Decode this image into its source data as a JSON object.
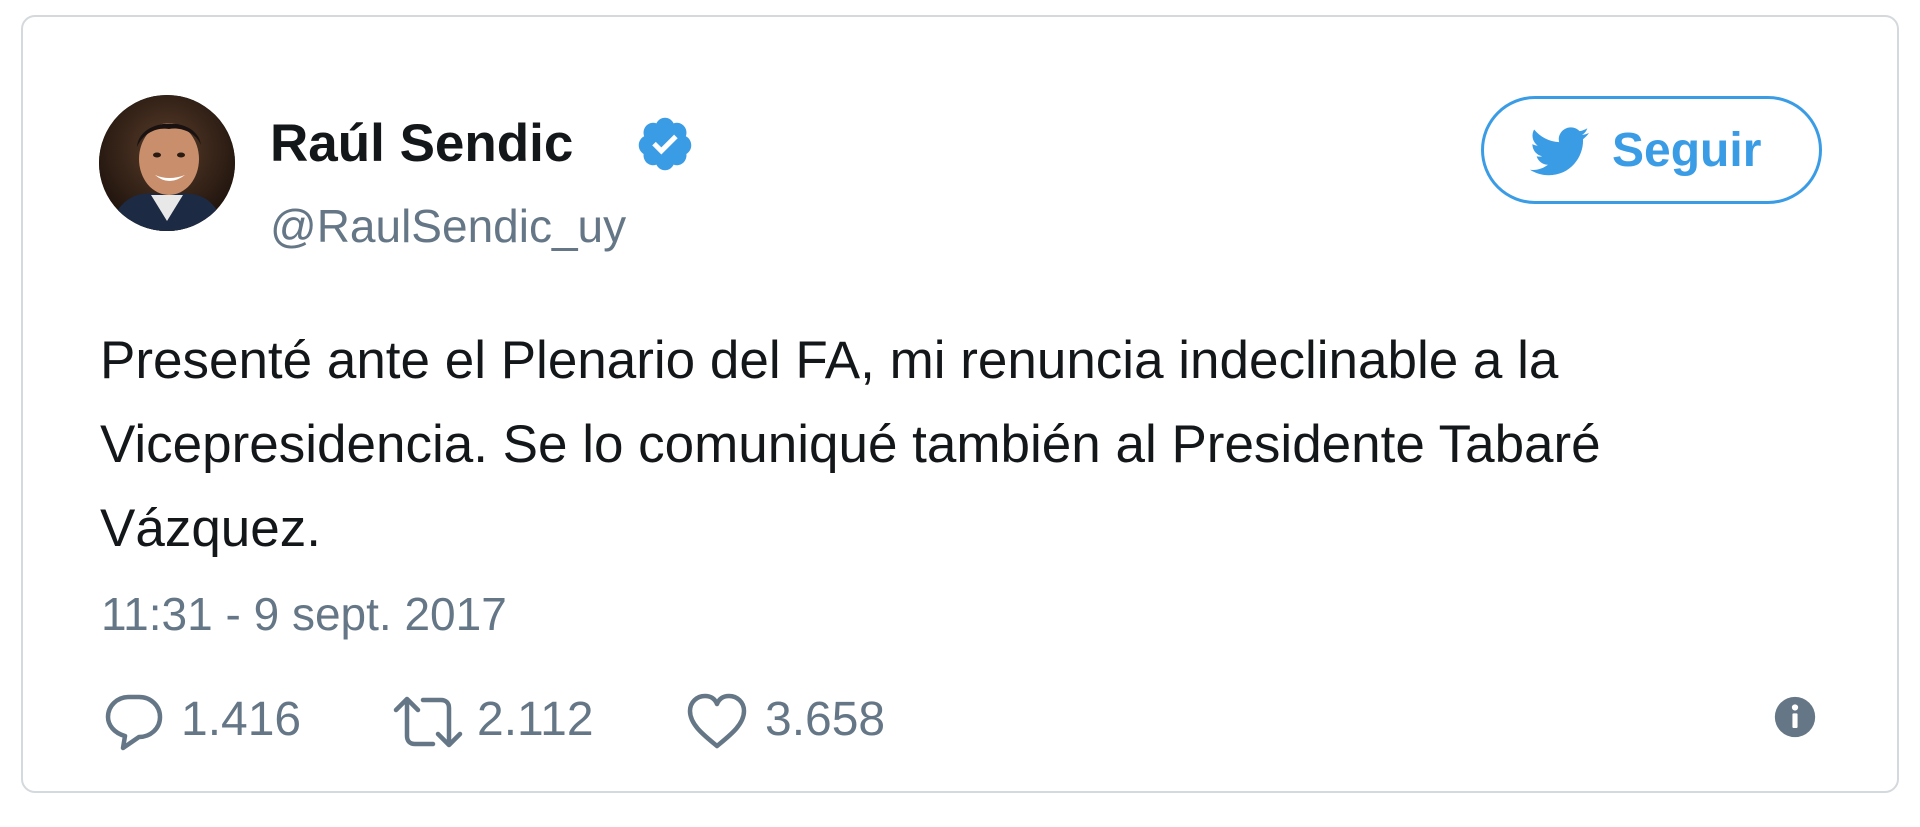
{
  "tweet": {
    "user": {
      "name": "Raúl Sendic",
      "handle": "@RaulSendic_uy",
      "verified": true
    },
    "follow_button": {
      "label": "Seguir",
      "icon": "twitter-bird-icon"
    },
    "text_lines": [
      "Presenté ante el Plenario del FA, mi renuncia indeclinable a la",
      "Vicepresidencia. Se lo comuniqué también al Presidente Tabaré",
      "Vázquez."
    ],
    "timestamp": "11:31 - 9 sept. 2017",
    "actions": {
      "replies": "1.416",
      "retweets": "2.112",
      "likes": "3.658"
    }
  },
  "colors": {
    "accent": "#3b9ce6",
    "text": "#14171a",
    "secondary": "#657786",
    "border": "#d4d9dd"
  }
}
